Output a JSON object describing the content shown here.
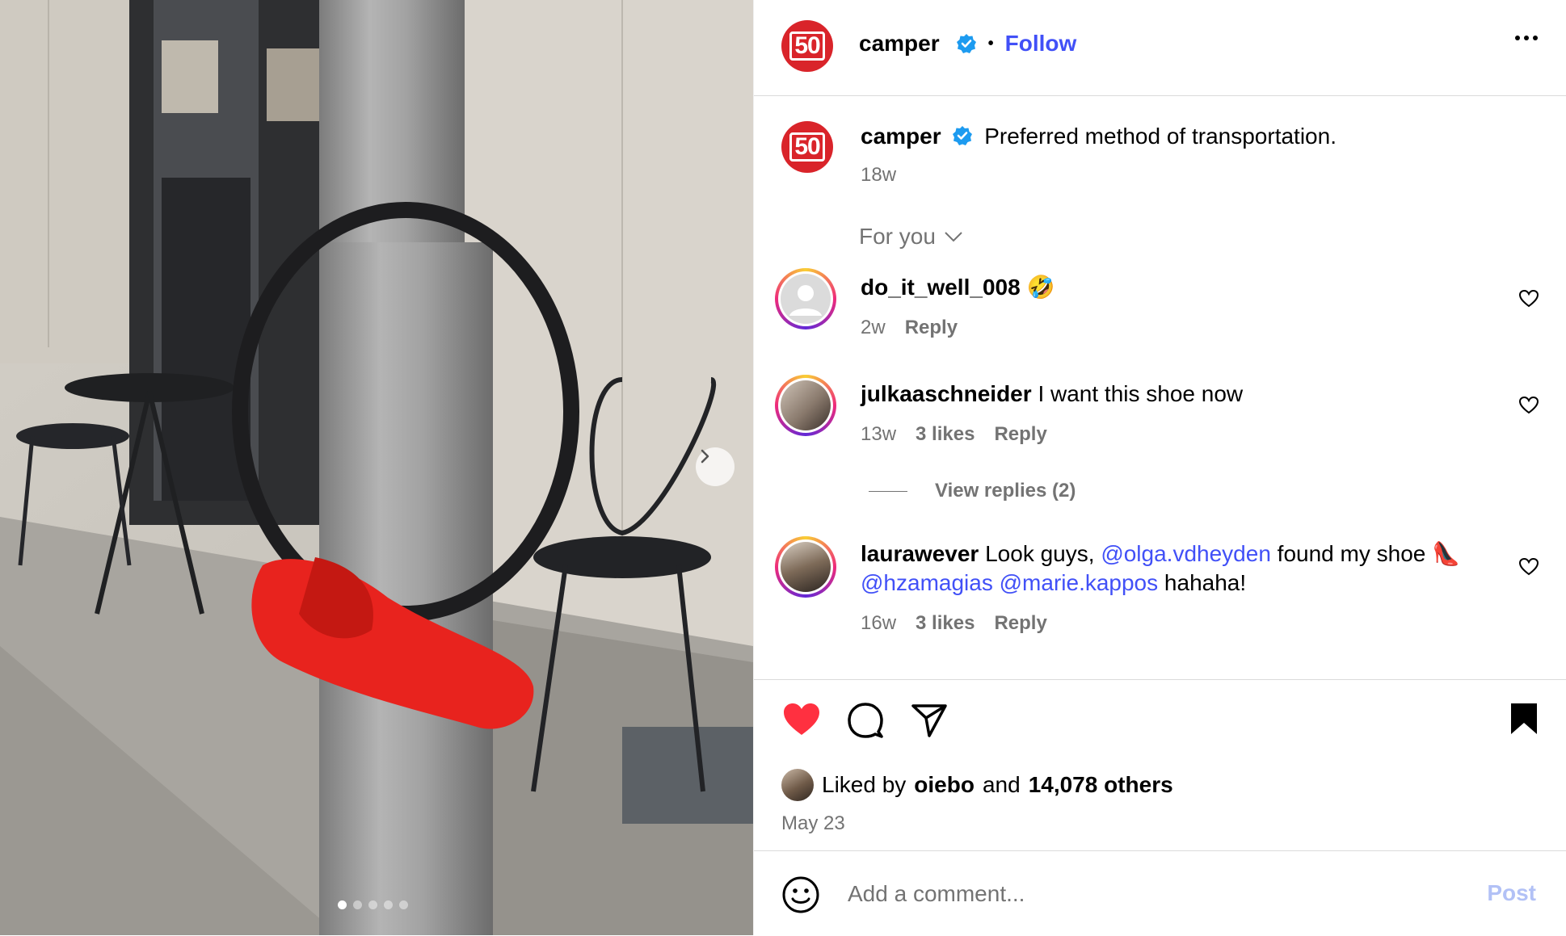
{
  "post": {
    "author": "camper",
    "avatar_text": "50",
    "follow_label": "Follow",
    "separator": "•",
    "caption": "Preferred method of transportation.",
    "caption_time": "18w"
  },
  "sort": {
    "label": "For you"
  },
  "comments": [
    {
      "user": "do_it_well_008",
      "text": "🤣",
      "time": "2w",
      "likes": "",
      "reply_label": "Reply"
    },
    {
      "user": "julkaaschneider",
      "text": "I want this shoe now",
      "time": "13w",
      "likes": "3 likes",
      "reply_label": "Reply",
      "view_replies": "View replies (2)"
    },
    {
      "user": "laurawever",
      "text_1": "Look guys,",
      "mention_1": "@olga.vdheyden",
      "text_2": "found my shoe 👠",
      "mention_2": "@hzamagias",
      "mention_3": "@marie.kappos",
      "text_3": "hahaha!",
      "time": "16w",
      "likes": "3 likes",
      "reply_label": "Reply"
    }
  ],
  "likes": {
    "prefix": "Liked by",
    "user": "oiebo",
    "middle": "and",
    "others": "14,078 others"
  },
  "date": "May 23",
  "add_comment": {
    "placeholder": "Add a comment...",
    "post_label": "Post"
  },
  "carousel": {
    "slide_count": 5,
    "active_index": 0
  },
  "colors": {
    "accent": "#4150f7",
    "like_red": "#ff3040",
    "brand_red": "#d9242a"
  }
}
